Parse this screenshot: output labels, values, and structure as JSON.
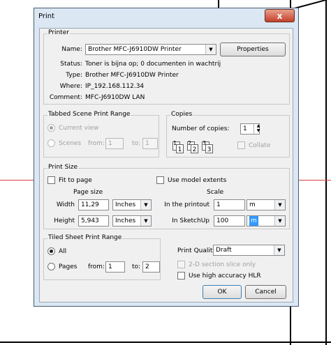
{
  "dialog": {
    "title": "Print",
    "close_symbol": "x"
  },
  "printer": {
    "group_label": "Printer",
    "name_label": "Name:",
    "name_value": "Brother MFC-J6910DW Printer",
    "properties_label": "Properties",
    "status_label": "Status:",
    "status_value": "Toner is bijna op; 0 documenten in wachtrij",
    "type_label": "Type:",
    "type_value": "Brother MFC-J6910DW Printer",
    "where_label": "Where:",
    "where_value": "IP_192.168.112.34",
    "comment_label": "Comment:",
    "comment_value": "MFC-J6910DW LAN"
  },
  "scene_range": {
    "group_label": "Tabbed Scene Print Range",
    "current_view_label": "Current view",
    "scenes_label": "Scenes",
    "from_label": "from:",
    "from_value": "1",
    "to_label": "to:",
    "to_value": "1"
  },
  "copies": {
    "group_label": "Copies",
    "number_label": "Number of copies:",
    "number_value": "1",
    "collate_label": "Collate",
    "page_digits": [
      "1",
      "1",
      "2",
      "2",
      "3",
      "3"
    ]
  },
  "print_size": {
    "group_label": "Print Size",
    "fit_label": "Fit to page",
    "model_extents_label": "Use model extents",
    "page_size_label": "Page size",
    "width_label": "Width",
    "width_value": "11,29",
    "width_unit": "Inches",
    "height_label": "Height",
    "height_value": "5,943",
    "height_unit": "Inches",
    "scale_label": "Scale",
    "printout_label": "In the printout",
    "printout_value": "1",
    "printout_unit": "m",
    "sketchup_label": "In SketchUp",
    "sketchup_value": "100",
    "sketchup_unit": "m"
  },
  "tiled": {
    "group_label": "Tiled Sheet Print Range",
    "all_label": "All",
    "pages_label": "Pages",
    "from_label": "from:",
    "from_value": "1",
    "to_label": "to:",
    "to_value": "2"
  },
  "quality": {
    "label": "Print Quality",
    "value": "Draft",
    "section_slice_label": "2-D section slice only",
    "hlr_label": "Use high accuracy HLR"
  },
  "buttons": {
    "ok_label": "OK",
    "cancel_label": "Cancel"
  },
  "colors": {
    "dialog_frame": "#dbe7f3",
    "client": "#f0f0f0",
    "close_button": "#c4402a",
    "selection": "#3399ff"
  }
}
